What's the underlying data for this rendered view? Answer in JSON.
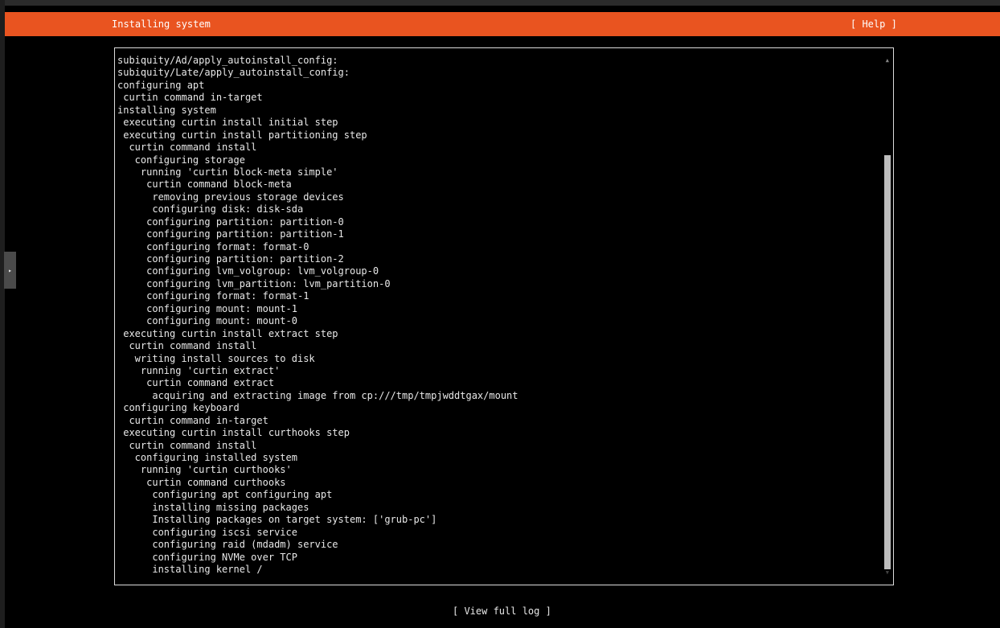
{
  "header": {
    "title": "Installing system",
    "help_label": "[ Help ]",
    "color": "#e95420"
  },
  "side_handle": {
    "icon": "triangle-right-icon",
    "glyph": "▸"
  },
  "log": {
    "lines": [
      "subiquity/Ad/apply_autoinstall_config:",
      "subiquity/Late/apply_autoinstall_config:",
      "configuring apt",
      " curtin command in-target",
      "installing system",
      " executing curtin install initial step",
      " executing curtin install partitioning step",
      "  curtin command install",
      "   configuring storage",
      "    running 'curtin block-meta simple'",
      "     curtin command block-meta",
      "      removing previous storage devices",
      "      configuring disk: disk-sda",
      "     configuring partition: partition-0",
      "     configuring partition: partition-1",
      "     configuring format: format-0",
      "     configuring partition: partition-2",
      "     configuring lvm_volgroup: lvm_volgroup-0",
      "     configuring lvm_partition: lvm_partition-0",
      "     configuring format: format-1",
      "     configuring mount: mount-1",
      "     configuring mount: mount-0",
      " executing curtin install extract step",
      "  curtin command install",
      "   writing install sources to disk",
      "    running 'curtin extract'",
      "     curtin command extract",
      "      acquiring and extracting image from cp:///tmp/tmpjwddtgax/mount",
      " configuring keyboard",
      "  curtin command in-target",
      " executing curtin install curthooks step",
      "  curtin command install",
      "   configuring installed system",
      "    running 'curtin curthooks'",
      "     curtin command curthooks",
      "      configuring apt configuring apt",
      "      installing missing packages",
      "      Installing packages on target system: ['grub-pc']",
      "      configuring iscsi service",
      "      configuring raid (mdadm) service",
      "      configuring NVMe over TCP",
      "      installing kernel /"
    ],
    "scroll": {
      "up_glyph": "▲",
      "down_glyph": "▼"
    }
  },
  "footer": {
    "view_log_label": "[ View full log ]"
  }
}
